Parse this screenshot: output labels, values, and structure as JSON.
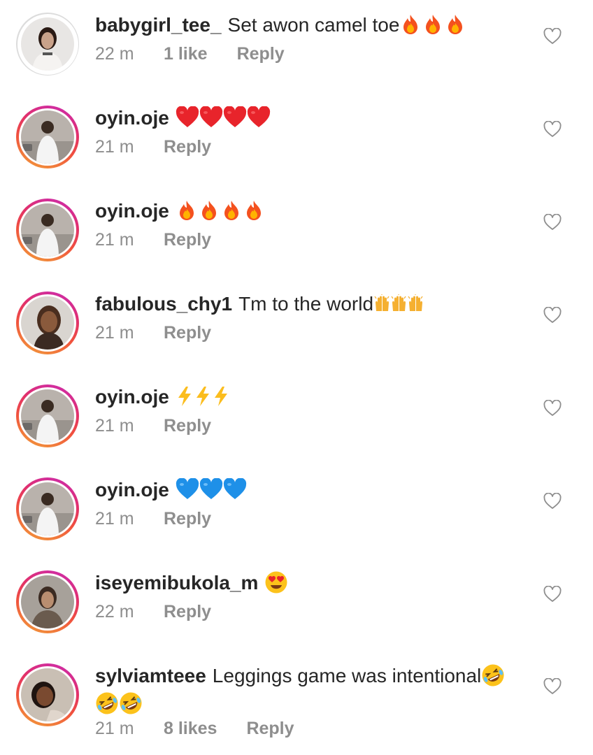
{
  "comments": [
    {
      "username": "babygirl_tee_",
      "text": "Set awon camel toe",
      "emoji": [
        "fire-emoji",
        "fire-emoji",
        "fire-emoji"
      ],
      "time": "22 m",
      "likes": "1 like",
      "reply": "Reply",
      "avatar_ring": "plain"
    },
    {
      "username": "oyin.oje",
      "text": "",
      "emoji": [
        "red-heart-emoji",
        "red-heart-emoji",
        "red-heart-emoji",
        "red-heart-emoji"
      ],
      "time": "21 m",
      "likes": "",
      "reply": "Reply",
      "avatar_ring": "story"
    },
    {
      "username": "oyin.oje",
      "text": "",
      "emoji": [
        "fire-emoji",
        "fire-emoji",
        "fire-emoji",
        "fire-emoji"
      ],
      "time": "21 m",
      "likes": "",
      "reply": "Reply",
      "avatar_ring": "story"
    },
    {
      "username": "fabulous_chy1",
      "text": "Tm to the world",
      "emoji": [
        "raising-hands-emoji",
        "raising-hands-emoji",
        "raising-hands-emoji"
      ],
      "time": "21 m",
      "likes": "",
      "reply": "Reply",
      "avatar_ring": "story"
    },
    {
      "username": "oyin.oje",
      "text": "",
      "emoji": [
        "lightning-emoji",
        "lightning-emoji",
        "lightning-emoji"
      ],
      "time": "21 m",
      "likes": "",
      "reply": "Reply",
      "avatar_ring": "story"
    },
    {
      "username": "oyin.oje",
      "text": "",
      "emoji": [
        "blue-heart-emoji",
        "blue-heart-emoji",
        "blue-heart-emoji"
      ],
      "time": "21 m",
      "likes": "",
      "reply": "Reply",
      "avatar_ring": "story"
    },
    {
      "username": "iseyemibukola_m",
      "text": "",
      "emoji": [
        "heart-eyes-emoji"
      ],
      "time": "22 m",
      "likes": "",
      "reply": "Reply",
      "avatar_ring": "story"
    },
    {
      "username": "sylviamteee",
      "text": "Leggings game was intentional",
      "emoji": [
        "rofl-emoji"
      ],
      "emoji_line2": [
        "rofl-emoji",
        "rofl-emoji"
      ],
      "time": "21 m",
      "likes": "8 likes",
      "reply": "Reply",
      "avatar_ring": "story"
    }
  ],
  "icons": {
    "like": "heart-outline-icon"
  },
  "colors": {
    "username": "#262626",
    "meta": "#8e8e8e",
    "story_ring_start": "#c92bb7",
    "story_ring_end": "#f2a23a"
  }
}
